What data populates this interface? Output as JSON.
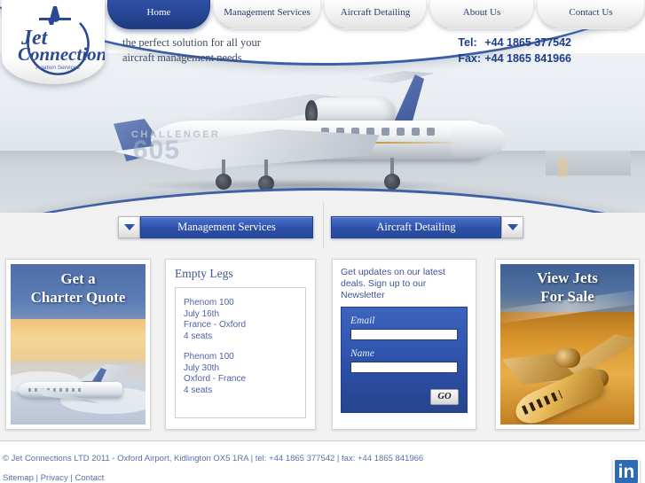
{
  "brand": {
    "name_line1": "Jet",
    "name_line2": "Connections",
    "tagline_small": "Aviation Services",
    "accent_blue": "#2a4899",
    "text_blue": "#3f5596"
  },
  "nav": {
    "tabs": [
      {
        "label": "Home",
        "active": true
      },
      {
        "label": "Management Services",
        "active": false
      },
      {
        "label": "Aircraft Detailing",
        "active": false
      },
      {
        "label": "About Us",
        "active": false
      },
      {
        "label": "Contact Us",
        "active": false
      }
    ]
  },
  "header": {
    "tagline_line1": "the perfect solution for all your",
    "tagline_line2": "aircraft management needs",
    "tel_label": "Tel:",
    "tel_value": "+44 1865 377542",
    "fax_label": "Fax:",
    "fax_value": "+44 1865 841966"
  },
  "hero": {
    "aircraft_model_text": "CHALLENGER",
    "aircraft_number_text": "605"
  },
  "service_buttons": [
    {
      "label": "Management Services",
      "arrow": "left"
    },
    {
      "label": "Aircraft Detailing",
      "arrow": "right"
    }
  ],
  "panels": {
    "charter": {
      "title_line1": "Get a",
      "title_line2": "Charter Quote"
    },
    "empty_legs": {
      "heading": "Empty Legs",
      "items": [
        {
          "aircraft": "Phenom 100",
          "date": "July 16th",
          "route": "France - Oxford",
          "seats": "4 seats"
        },
        {
          "aircraft": "Phenom 100",
          "date": "July 30th",
          "route": "Oxford - France",
          "seats": "4 seats"
        }
      ]
    },
    "newsletter": {
      "intro": "Get updates on our latest deals. Sign up to our Newsletter",
      "email_label": "Email",
      "email_value": "",
      "email_placeholder": "",
      "name_label": "Name",
      "name_value": "",
      "name_placeholder": "",
      "submit_label": "GO"
    },
    "jets_for_sale": {
      "title_line1": "View Jets",
      "title_line2": "For Sale"
    }
  },
  "footer": {
    "copyright": "© Jet Connections LTD 2011 - Oxford Airport, Kidlington OX5 1RA | tel: +44 1865 377542 | fax: +44 1865 841966",
    "link_sitemap": "Sitemap",
    "link_sep1": " | ",
    "link_privacy": "Privacy",
    "link_sep2": " | ",
    "link_contact": "Contact",
    "social_label": "in"
  }
}
